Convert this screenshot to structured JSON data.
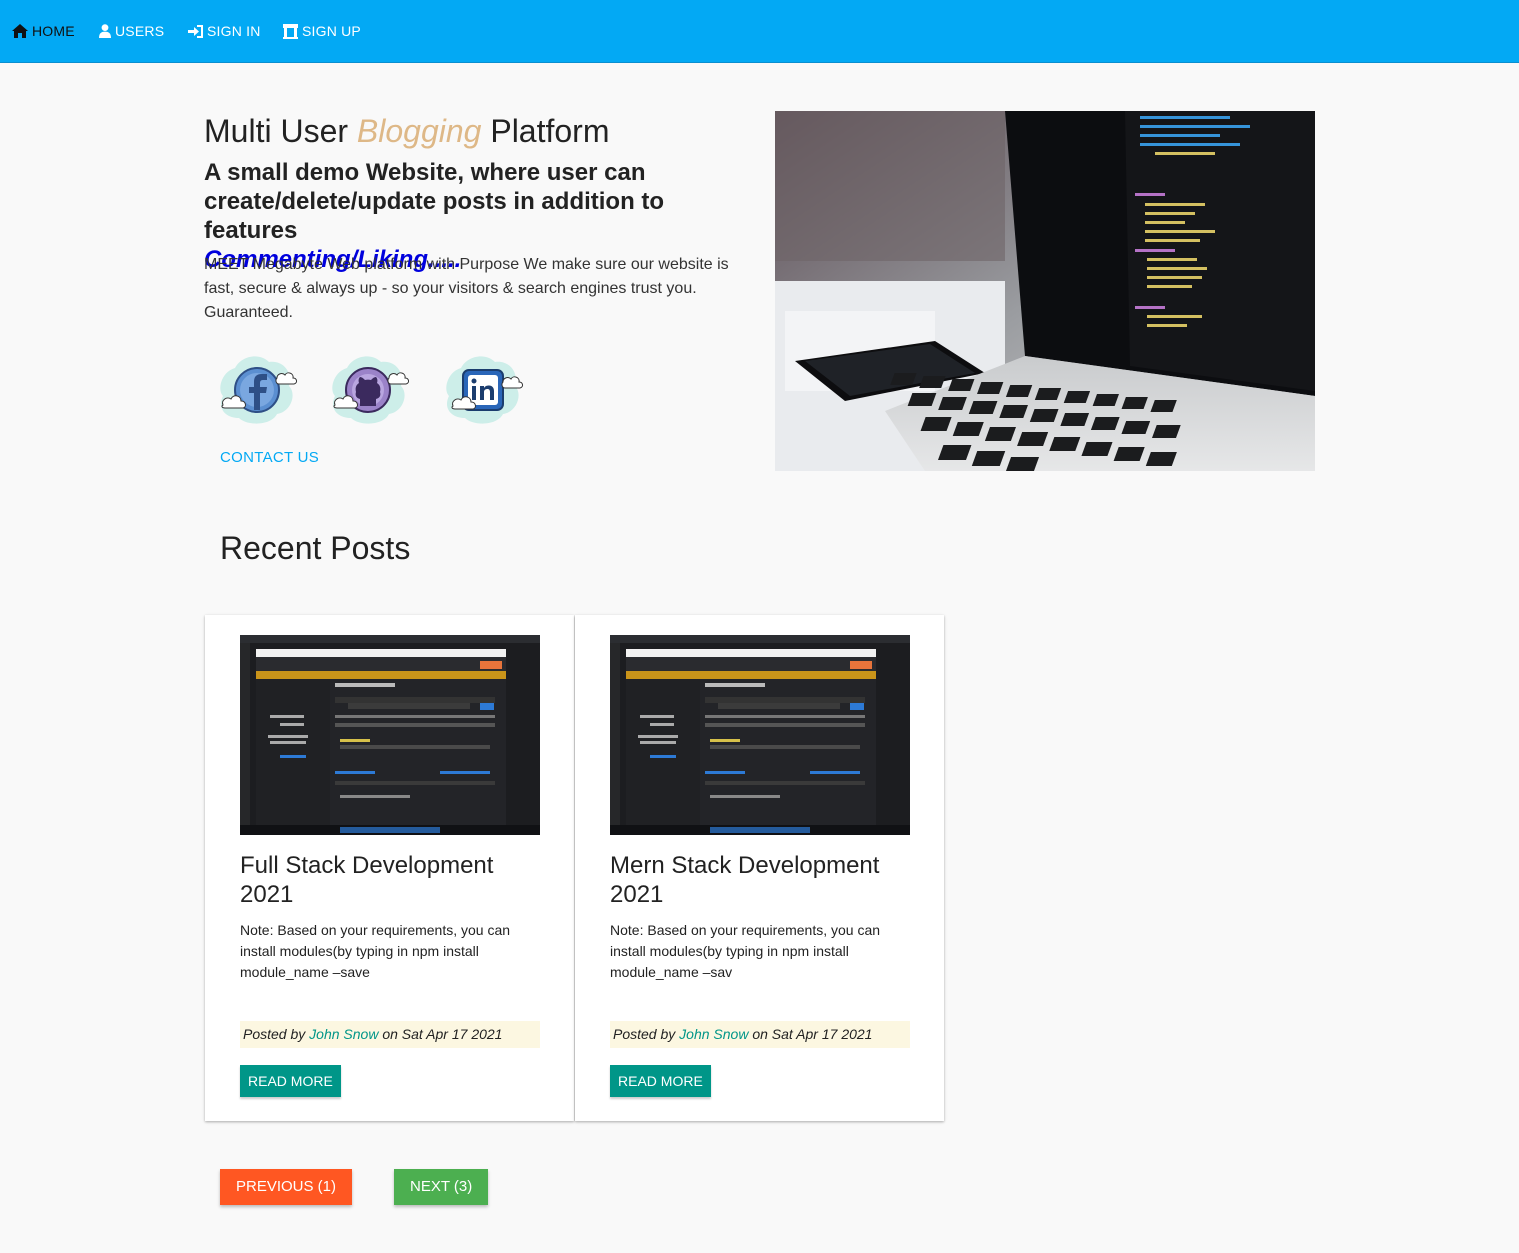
{
  "nav": {
    "items": [
      {
        "label": "HOME",
        "icon": "home-icon"
      },
      {
        "label": "USERS",
        "icon": "user-icon"
      },
      {
        "label": "SIGN IN",
        "icon": "sign-in-icon"
      },
      {
        "label": "SIGN UP",
        "icon": "institution-icon"
      }
    ],
    "active": "HOME"
  },
  "hero": {
    "title_pre": "Multi User ",
    "title_accent": "Blogging",
    "title_post": " Platform",
    "subtitle": "A small demo Website, where user can create/delete/update posts in addition to features",
    "subtitle_features": "Commenting/Liking.....",
    "description": "MEET Megabyte Web platform with Purpose We make sure our website is fast, secure & always up - so your visitors & search engines trust you. Guaranteed.",
    "social": [
      {
        "name": "facebook",
        "icon": "facebook-icon"
      },
      {
        "name": "github",
        "icon": "github-icon"
      },
      {
        "name": "linkedin",
        "icon": "linkedin-icon"
      }
    ],
    "contact_label": "CONTACT US",
    "image_icon": "laptop-code-photo"
  },
  "recent": {
    "title": "Recent Posts",
    "posts": [
      {
        "title": "Full Stack Development 2021",
        "excerpt": "Note: Based on your requirements, you can install modules(by typing in npm install module_name –save",
        "posted_by": "Posted by",
        "author": "John Snow",
        "on": "on",
        "date": "Sat Apr 17 2021",
        "read_more": "READ MORE"
      },
      {
        "title": "Mern Stack Development 2021",
        "excerpt": "Note: Based on your requirements, you can install modules(by typing in npm install module_name –sav",
        "posted_by": "Posted by",
        "author": "John Snow",
        "on": "on",
        "date": "Sat Apr 17 2021",
        "read_more": "READ MORE"
      }
    ]
  },
  "pagination": {
    "previous_label": "PREVIOUS (1)",
    "next_label": "NEXT (3)"
  },
  "colors": {
    "nav_bg": "#03a9f4",
    "accent_text": "#deb887",
    "feature_text": "#0000dd",
    "teal": "#009688",
    "previous_bg": "#ff5722",
    "next_bg": "#4caf50",
    "meta_bg": "#fcf7e1"
  }
}
